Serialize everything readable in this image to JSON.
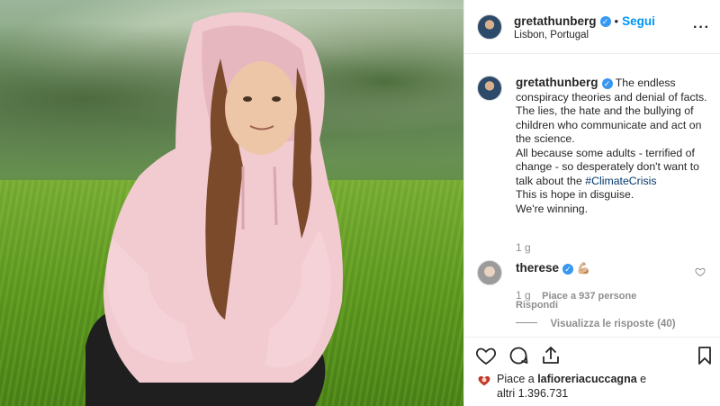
{
  "post": {
    "username": "gretathunberg",
    "verified_mark": "✓",
    "dot": "•",
    "follow_label": "Segui",
    "location": "Lisbon, Portugal",
    "more_label": "···"
  },
  "caption": {
    "username": "gretathunberg",
    "line1_pre": "The endless conspiracy theories and denial of facts.",
    "line2": "The lies, the hate and the bullying of children who communicate and act on the science.",
    "line3_pre": "All because some adults - terrified of change - so desperately don't want to talk about the ",
    "hashtag": "#ClimateCrisis",
    "line4": "This is hope in disguise.",
    "line5": "We're winning.",
    "time": "1 g"
  },
  "comment": {
    "username": "therese",
    "emoji": "💪🏼",
    "time": "1 g",
    "likes": "Piace a 937 persone",
    "reply": "Rispondi",
    "view_replies": "Visualizza le risposte (40)"
  },
  "likes": {
    "prefix": "Piace a",
    "user": "lafioreriacuccagna",
    "and": "e",
    "others": "altri 1.396.731"
  },
  "colors": {
    "accent": "#0095f6",
    "verified": "#3897f0",
    "muted": "#8e8e8e"
  },
  "icons": [
    "heart-icon",
    "comment-icon",
    "share-icon",
    "bookmark-icon",
    "more-icon",
    "small-heart-icon"
  ]
}
